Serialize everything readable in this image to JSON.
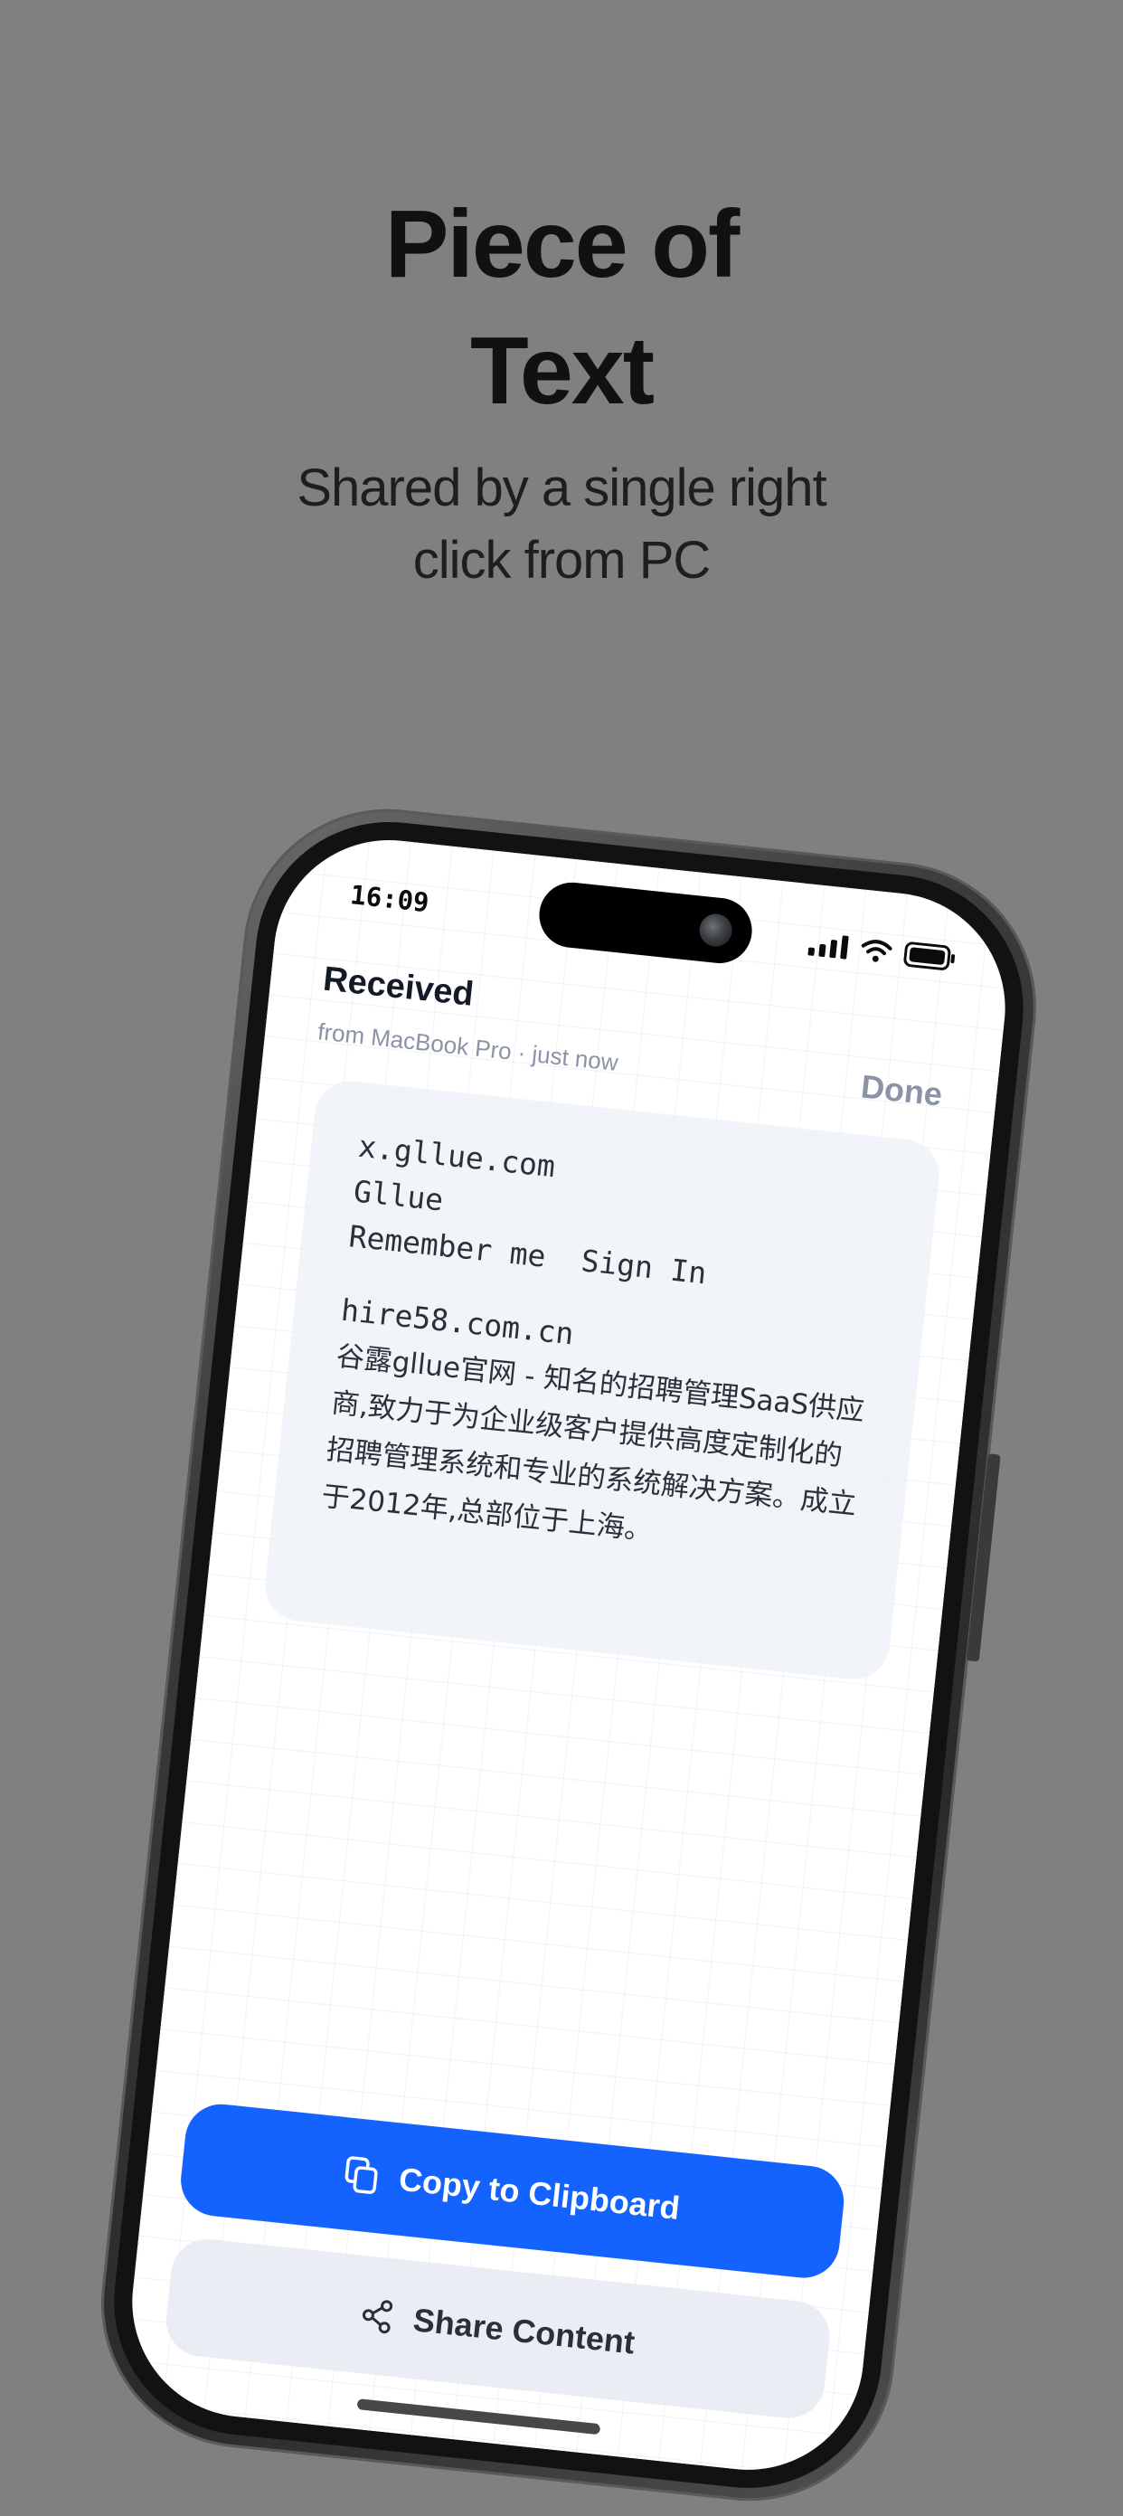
{
  "promo": {
    "headline": [
      "Piece of",
      "Text"
    ],
    "subhead": [
      "Shared by a single right",
      "click from PC"
    ]
  },
  "status_bar": {
    "time": "16:09",
    "icons": [
      "signal-icon",
      "wifi-icon",
      "battery-icon"
    ]
  },
  "sheet": {
    "title": "Received",
    "subtitle": "from MacBook Pro · just now",
    "done_label": "Done"
  },
  "shared_text": {
    "lines": [
      "x.gllue.com",
      "Gllue",
      "Remember me  Sign In"
    ],
    "url_line": "hire58.com.cn",
    "paragraph": "谷露gllue官网 - 知名的招聘管理SaaS供应商,致力于为企业级客户提供高度定制化的招聘管理系统和专业的系统解决方案。成立于2012年,总部位于上海。"
  },
  "actions": {
    "copy_label": "Copy to Clipboard",
    "share_label": "Share Content",
    "copy_icon": "copy-icon",
    "share_icon": "share-icon"
  },
  "colors": {
    "background": "#808080",
    "primary": "#1463ff",
    "muted_text": "#8a94a6"
  }
}
